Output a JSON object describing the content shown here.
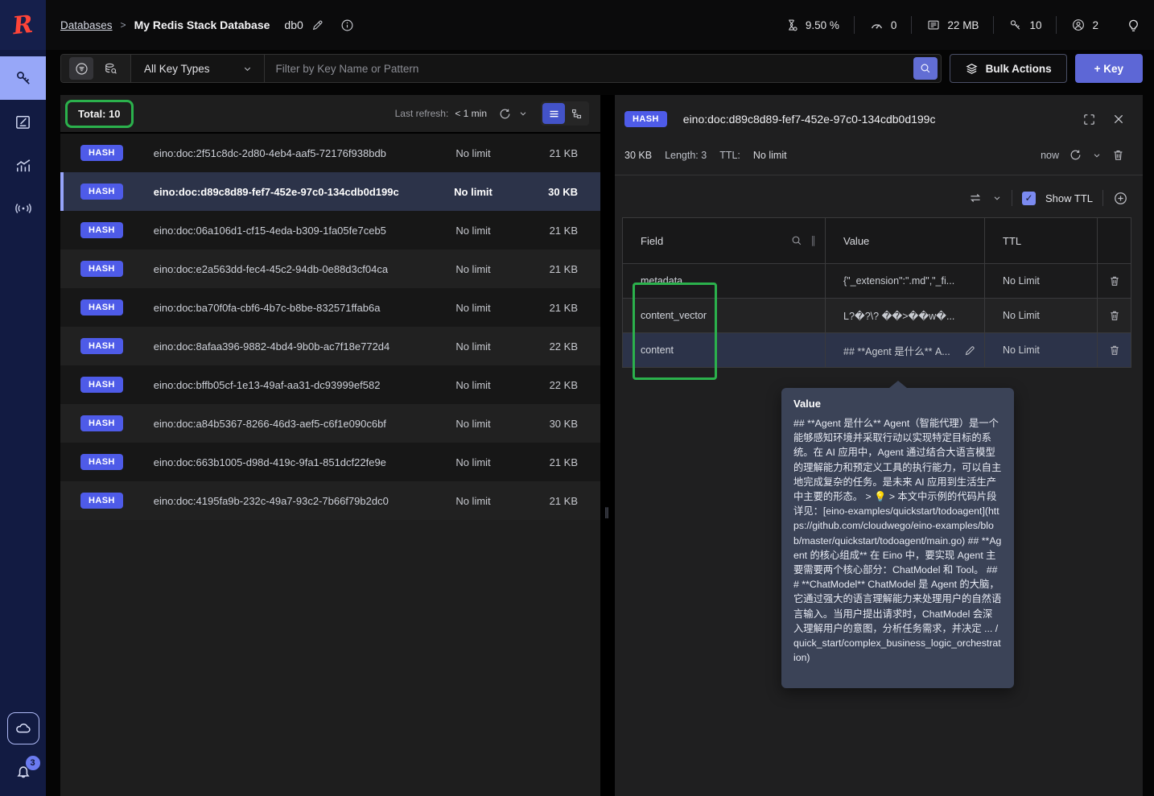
{
  "colors": {
    "accent": "#5d67d6",
    "hash_badge": "#4e5be8",
    "annotation_green": "#2bb14c",
    "redis_red": "#ff4438",
    "nav_active": "#97a7f8"
  },
  "header": {
    "breadcrumb_root": "Databases",
    "breadcrumb_separator": ">",
    "breadcrumb_current": "My Redis Stack Database",
    "db_label": "db0",
    "metrics": {
      "cpu": "9.50 %",
      "ops": "0",
      "memory": "22 MB",
      "keys": "10",
      "clients": "2"
    }
  },
  "sidebar": {
    "notifications_badge": "3"
  },
  "filter_bar": {
    "key_type_selected": "All Key Types",
    "filter_placeholder": "Filter by Key Name or Pattern",
    "bulk_actions_label": "Bulk Actions",
    "add_key_label": "+ Key"
  },
  "key_list": {
    "total_label": "Total: 10",
    "last_refresh_label": "Last refresh:",
    "last_refresh_value": "< 1 min",
    "rows": [
      {
        "type": "HASH",
        "name": "eino:doc:2f51c8dc-2d80-4eb4-aaf5-72176f938bdb",
        "ttl": "No limit",
        "size": "21 KB"
      },
      {
        "type": "HASH",
        "name": "eino:doc:d89c8d89-fef7-452e-97c0-134cdb0d199c",
        "ttl": "No limit",
        "size": "30 KB"
      },
      {
        "type": "HASH",
        "name": "eino:doc:06a106d1-cf15-4eda-b309-1fa05fe7ceb5",
        "ttl": "No limit",
        "size": "21 KB"
      },
      {
        "type": "HASH",
        "name": "eino:doc:e2a563dd-fec4-45c2-94db-0e88d3cf04ca",
        "ttl": "No limit",
        "size": "21 KB"
      },
      {
        "type": "HASH",
        "name": "eino:doc:ba70f0fa-cbf6-4b7c-b8be-832571ffab6a",
        "ttl": "No limit",
        "size": "21 KB"
      },
      {
        "type": "HASH",
        "name": "eino:doc:8afaa396-9882-4bd4-9b0b-ac7f18e772d4",
        "ttl": "No limit",
        "size": "22 KB"
      },
      {
        "type": "HASH",
        "name": "eino:doc:bffb05cf-1e13-49af-aa31-dc93999ef582",
        "ttl": "No limit",
        "size": "22 KB"
      },
      {
        "type": "HASH",
        "name": "eino:doc:a84b5367-8266-46d3-aef5-c6f1e090c6bf",
        "ttl": "No limit",
        "size": "30 KB"
      },
      {
        "type": "HASH",
        "name": "eino:doc:663b1005-d98d-419c-9fa1-851dcf22fe9e",
        "ttl": "No limit",
        "size": "21 KB"
      },
      {
        "type": "HASH",
        "name": "eino:doc:4195fa9b-232c-49a7-93c2-7b66f79b2dc0",
        "ttl": "No limit",
        "size": "21 KB"
      }
    ]
  },
  "details": {
    "type_badge": "HASH",
    "key_name": "eino:doc:d89c8d89-fef7-452e-97c0-134cdb0d199c",
    "size": "30 KB",
    "length_label": "Length: 3",
    "ttl_label": "TTL:",
    "ttl_value": "No limit",
    "refresh_time": "now",
    "show_ttl_label": "Show TTL",
    "table": {
      "col_field": "Field",
      "col_value": "Value",
      "col_ttl": "TTL",
      "rows": [
        {
          "field": "metadata",
          "value": "{\"_extension\":\".md\",\"_fi...",
          "ttl": "No Limit"
        },
        {
          "field": "content_vector",
          "value": "L?�?\\? ��>��w�...",
          "ttl": "No Limit"
        },
        {
          "field": "content",
          "value": "## **Agent 是什么** A...",
          "ttl": "No Limit"
        }
      ]
    }
  },
  "tooltip": {
    "title": "Value",
    "body": "## **Agent 是什么** Agent（智能代理）是一个能够感知环境并采取行动以实现特定目标的系统。在 AI 应用中，Agent 通过结合大语言模型的理解能力和预定义工具的执行能力，可以自主地完成复杂的任务。是未来 AI 应用到生活生产中主要的形态。 > 💡 > 本文中示例的代码片段详见：[eino-examples/quickstart/todoagent](https://github.com/cloudwego/eino-examples/blob/master/quickstart/todoagent/main.go) ## **Agent 的核心组成** 在 Eino 中，要实现 Agent 主要需要两个核心部分：ChatModel 和 Tool。 ### **ChatModel** ChatModel 是 Agent 的大脑，它通过强大的语言理解能力来处理用户的自然语言输入。当用户提出请求时，ChatModel 会深入理解用户的意图，分析任务需求，并决定 ... /quick_start/complex_business_logic_orchestration)"
  }
}
